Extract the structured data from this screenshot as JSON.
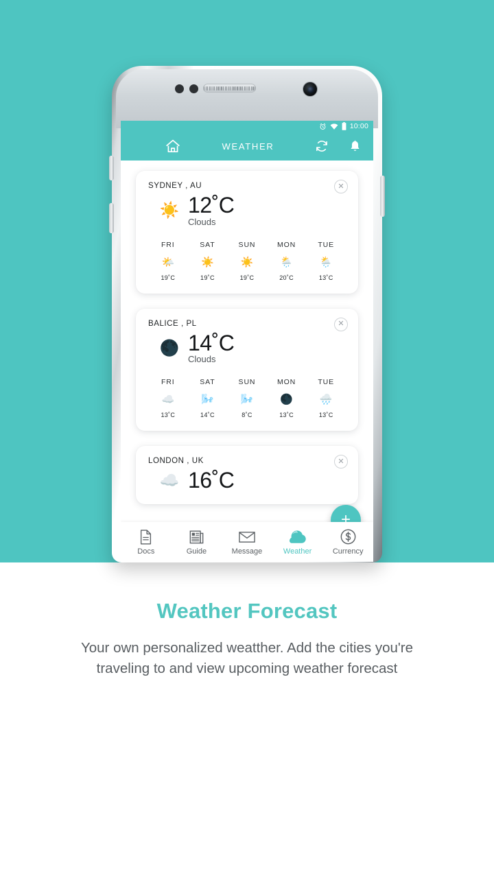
{
  "theme": {
    "background_teal": "#4ec5c1",
    "accent": "#53c6c0",
    "card_white": "#ffffff",
    "text_dark": "#1d2022",
    "text_muted": "#585d61"
  },
  "phone": {
    "status_bar": {
      "time": "10:00",
      "icons": [
        "alarm-icon",
        "wifi-icon",
        "battery-icon"
      ]
    },
    "app_bar": {
      "menu_icon": "hamburger-menu-icon",
      "home_icon": "home-icon",
      "title": "WEATHER",
      "refresh_icon": "refresh-icon",
      "notification_icon": "bell-icon"
    },
    "fab": {
      "label": "+",
      "icon": "plus-icon"
    },
    "cards": [
      {
        "city": "SYDNEY , AU",
        "close_icon": "close-icon",
        "current_icon": "sun-icon",
        "current_icon_glyph": "☀️",
        "temperature": "12˚C",
        "description": "Clouds",
        "forecast": [
          {
            "day": "FRI",
            "icon": "sun-behind-cloud-icon",
            "glyph": "🌤️",
            "temp": "19˚C"
          },
          {
            "day": "SAT",
            "icon": "sun-icon",
            "glyph": "☀️",
            "temp": "19˚C"
          },
          {
            "day": "SUN",
            "icon": "sun-icon",
            "glyph": "☀️",
            "temp": "19˚C"
          },
          {
            "day": "MON",
            "icon": "sun-behind-rain-cloud-icon",
            "glyph": "🌦️",
            "temp": "20˚C"
          },
          {
            "day": "TUE",
            "icon": "sun-behind-rain-cloud-icon",
            "glyph": "🌦️",
            "temp": "13˚C"
          }
        ]
      },
      {
        "city": "BALICE , PL",
        "close_icon": "close-icon",
        "current_icon": "dust-sun-icon",
        "current_icon_glyph": "🌑",
        "temperature": "14˚C",
        "description": "Clouds",
        "forecast": [
          {
            "day": "FRI",
            "icon": "cloud-icon",
            "glyph": "☁️",
            "temp": "13˚C"
          },
          {
            "day": "SAT",
            "icon": "wind-cloud-icon",
            "glyph": "🌬️",
            "temp": "14˚C"
          },
          {
            "day": "SUN",
            "icon": "wind-cloud-icon",
            "glyph": "🌬️",
            "temp": "8˚C"
          },
          {
            "day": "MON",
            "icon": "dust-sun-icon",
            "glyph": "🌑",
            "temp": "13˚C"
          },
          {
            "day": "TUE",
            "icon": "rain-dust-icon",
            "glyph": "🌧️",
            "temp": "13˚C"
          }
        ]
      },
      {
        "city": "LONDON , UK",
        "close_icon": "close-icon",
        "current_icon": "cloud-icon",
        "current_icon_glyph": "☁️",
        "temperature": "16˚C",
        "description": "",
        "forecast": []
      }
    ],
    "bottom_nav": [
      {
        "label": "Docs",
        "icon": "document-icon",
        "active": false
      },
      {
        "label": "Guide",
        "icon": "newspaper-icon",
        "active": false
      },
      {
        "label": "Message",
        "icon": "envelope-icon",
        "active": false
      },
      {
        "label": "Weather",
        "icon": "cloud-filled-icon",
        "active": true
      },
      {
        "label": "Currency",
        "icon": "dollar-circle-icon",
        "active": false
      }
    ]
  },
  "promo": {
    "title": "Weather Forecast",
    "description": "Your own personalized weatther. Add the cities you're traveling to and view upcoming weather forecast"
  }
}
